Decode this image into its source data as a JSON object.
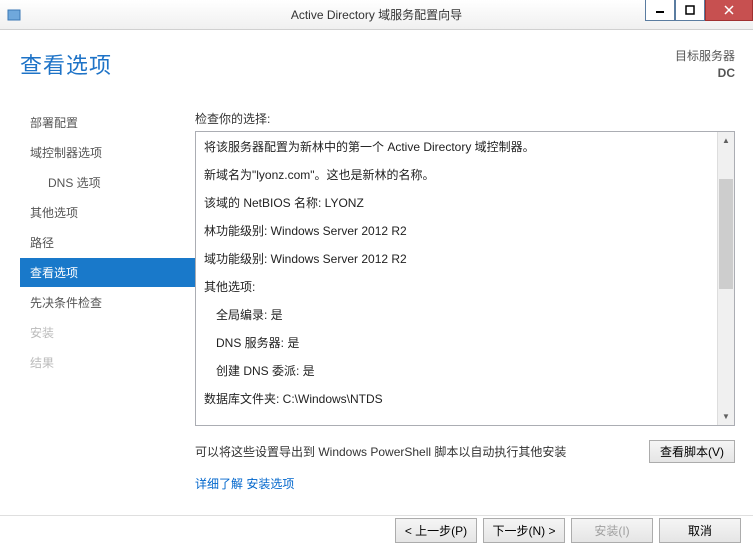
{
  "window": {
    "title": "Active Directory 域服务配置向导"
  },
  "target": {
    "label": "目标服务器",
    "name": "DC"
  },
  "page_title": "查看选项",
  "nav": {
    "items": [
      {
        "label": "部署配置"
      },
      {
        "label": "域控制器选项"
      },
      {
        "label": "DNS 选项"
      },
      {
        "label": "其他选项"
      },
      {
        "label": "路径"
      },
      {
        "label": "查看选项"
      },
      {
        "label": "先决条件检查"
      },
      {
        "label": "安装"
      },
      {
        "label": "结果"
      }
    ]
  },
  "review": {
    "heading": "检查你的选择:",
    "lines": {
      "l0": "将该服务器配置为新林中的第一个 Active Directory 域控制器。",
      "l1": "新域名为\"lyonz.com\"。这也是新林的名称。",
      "l2": "该域的 NetBIOS 名称: LYONZ",
      "l3": "林功能级别: Windows Server 2012 R2",
      "l4": "域功能级别: Windows Server 2012 R2",
      "l5": "其他选项:",
      "l6": "全局编录: 是",
      "l7": "DNS 服务器: 是",
      "l8": "创建 DNS 委派: 是",
      "l9": "数据库文件夹: C:\\Windows\\NTDS"
    }
  },
  "export": {
    "text": "可以将这些设置导出到 Windows PowerShell 脚本以自动执行其他安装",
    "button": "查看脚本(V)"
  },
  "link": {
    "text": "详细了解 安装选项"
  },
  "footer": {
    "prev": "< 上一步(P)",
    "next": "下一步(N) >",
    "install": "安装(I)",
    "cancel": "取消"
  }
}
